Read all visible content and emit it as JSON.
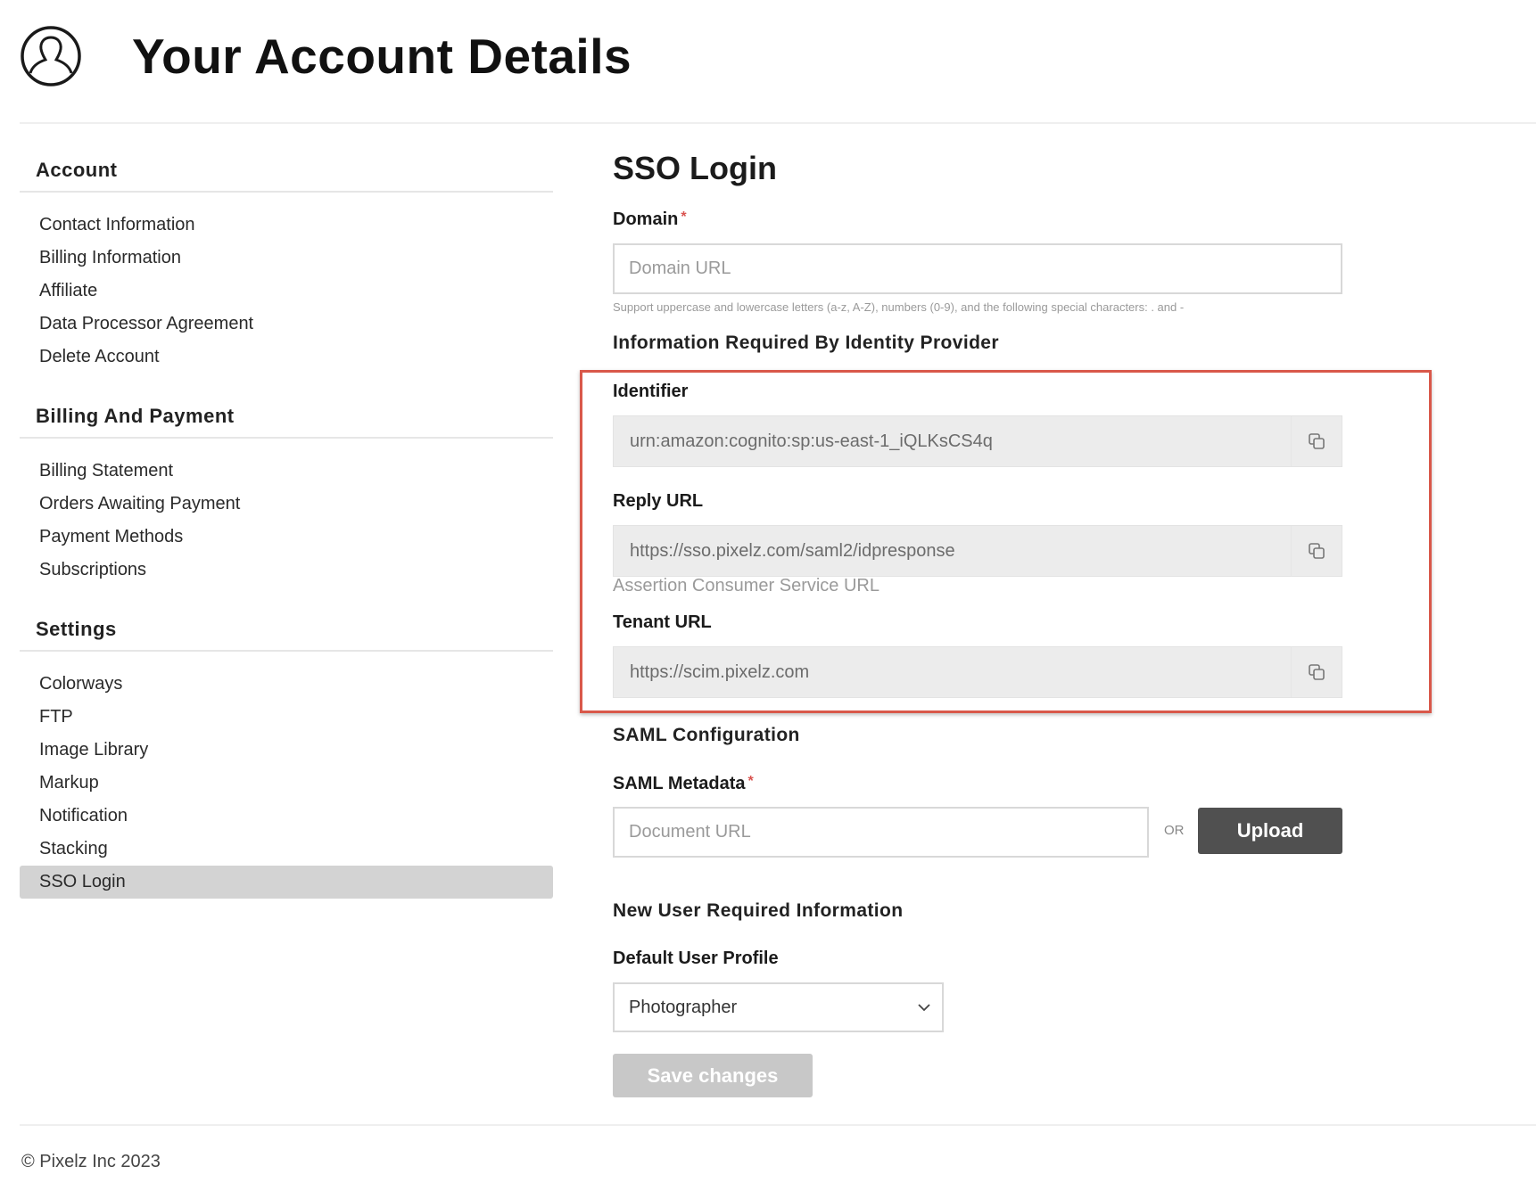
{
  "header": {
    "title": "Your Account Details",
    "icon": "user-circle-icon"
  },
  "sidebar": {
    "sections": [
      {
        "title": "Account",
        "items": [
          "Contact Information",
          "Billing Information",
          "Affiliate",
          "Data Processor Agreement",
          "Delete Account"
        ]
      },
      {
        "title": "Billing And Payment",
        "items": [
          "Billing Statement",
          "Orders Awaiting Payment",
          "Payment Methods",
          "Subscriptions"
        ]
      },
      {
        "title": "Settings",
        "items": [
          "Colorways",
          "FTP",
          "Image Library",
          "Markup",
          "Notification",
          "Stacking",
          "SSO Login"
        ]
      }
    ],
    "active_item": "SSO Login"
  },
  "main": {
    "title": "SSO Login",
    "domain": {
      "label": "Domain",
      "required_mark": "*",
      "placeholder": "Domain URL",
      "help": "Support uppercase and lowercase letters (a-z, A-Z), numbers (0-9), and the following special characters: . and -"
    },
    "idp_section_title": "Information Required By Identity Provider",
    "identifier": {
      "label": "Identifier",
      "value": "urn:amazon:cognito:sp:us-east-1_iQLKsCS4q"
    },
    "reply_url": {
      "label": "Reply URL",
      "value": "https://sso.pixelz.com/saml2/idpresponse",
      "help": "Assertion Consumer Service URL"
    },
    "tenant_url": {
      "label": "Tenant URL",
      "value": "https://scim.pixelz.com"
    },
    "saml_section_title": "SAML Configuration",
    "saml_metadata": {
      "label": "SAML Metadata",
      "required_mark": "*",
      "placeholder": "Document URL",
      "or_text": "OR",
      "upload_label": "Upload"
    },
    "new_user_section_title": "New User Required Information",
    "default_profile": {
      "label": "Default User Profile",
      "selected": "Photographer"
    },
    "save_label": "Save changes"
  },
  "footer": {
    "copyright": "© Pixelz Inc 2023"
  },
  "colors": {
    "highlight": "#d9584a",
    "upload_bg": "#505050",
    "save_disabled_bg": "#c8c8c8",
    "active_nav_bg": "#d3d3d3"
  }
}
